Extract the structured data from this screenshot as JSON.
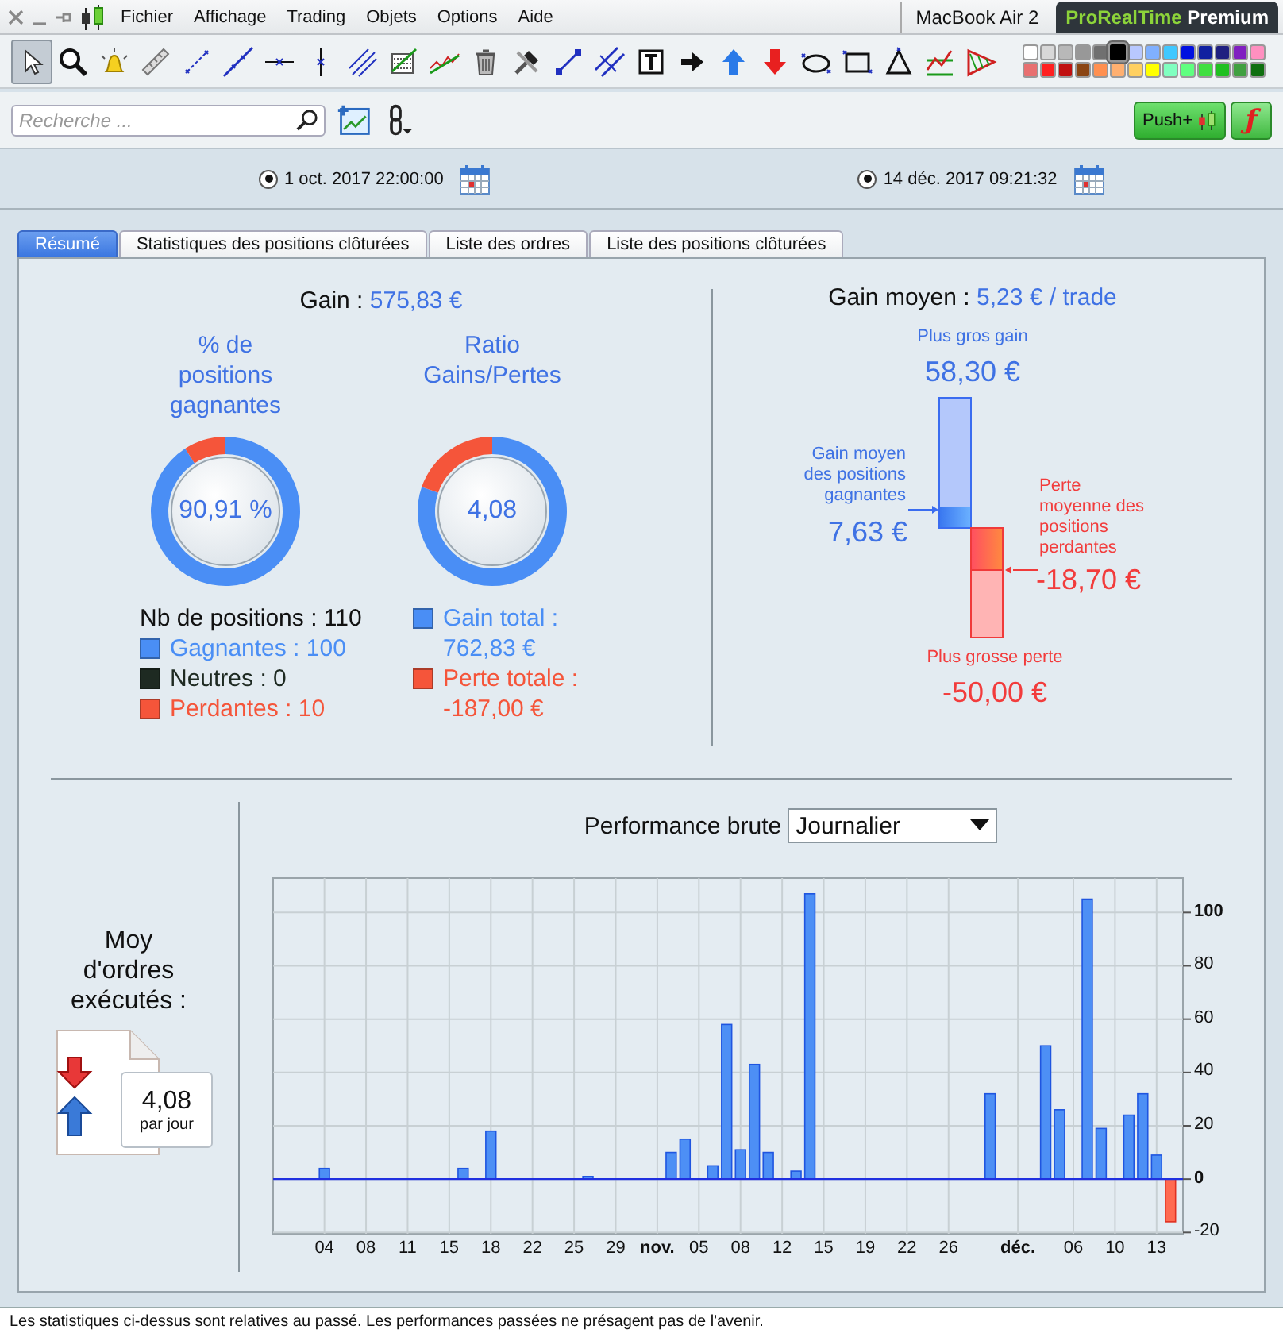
{
  "menu_bar": {
    "items": [
      "Fichier",
      "Affichage",
      "Trading",
      "Objets",
      "Options",
      "Aide"
    ],
    "device": "MacBook Air 2",
    "brand": {
      "name": "ProRealTime",
      "edition": "Premium"
    }
  },
  "toolbar": {
    "tools": [
      {
        "kind": "pointer",
        "selected": true
      },
      {
        "kind": "zoom",
        "selected": false
      },
      {
        "kind": "alert",
        "selected": false
      },
      {
        "kind": "ruler",
        "selected": false
      },
      {
        "kind": "segment",
        "selected": false
      },
      {
        "kind": "line",
        "selected": false
      },
      {
        "kind": "hline",
        "selected": false
      },
      {
        "kind": "vline",
        "selected": false
      },
      {
        "kind": "channel",
        "selected": false
      },
      {
        "kind": "grid",
        "selected": false
      },
      {
        "kind": "wave",
        "selected": false
      },
      {
        "kind": "trash",
        "selected": false
      },
      {
        "kind": "tools",
        "selected": false
      },
      {
        "kind": "extend",
        "selected": false
      },
      {
        "kind": "parallel",
        "selected": false
      },
      {
        "kind": "text",
        "selected": false
      },
      {
        "kind": "arrow_right",
        "selected": false
      },
      {
        "kind": "arrow_up",
        "selected": false
      },
      {
        "kind": "arrow_down",
        "selected": false
      },
      {
        "kind": "ellipse",
        "selected": false
      },
      {
        "kind": "rectangle",
        "selected": false
      },
      {
        "kind": "triangle",
        "selected": false
      },
      {
        "kind": "trend",
        "selected": false
      },
      {
        "kind": "wedge",
        "selected": false
      }
    ],
    "palette": [
      {
        "color": "#ffffff",
        "selected": false
      },
      {
        "color": "#d8d8d8",
        "selected": false
      },
      {
        "color": "#b8b8b8",
        "selected": false
      },
      {
        "color": "#989898",
        "selected": false
      },
      {
        "color": "#707070",
        "selected": false
      },
      {
        "color": "#000000",
        "selected": true
      },
      {
        "color": "#b8c8ff",
        "selected": false
      },
      {
        "color": "#80b0ff",
        "selected": false
      },
      {
        "color": "#40c8ff",
        "selected": false
      },
      {
        "color": "#0010e0",
        "selected": false
      },
      {
        "color": "#1020a0",
        "selected": false
      },
      {
        "color": "#202080",
        "selected": false
      },
      {
        "color": "#8020c0",
        "selected": false
      },
      {
        "color": "#ff90c0",
        "selected": false
      },
      {
        "color": "#e87070",
        "selected": false
      },
      {
        "color": "#ff2020",
        "selected": false
      },
      {
        "color": "#c01010",
        "selected": false
      },
      {
        "color": "#8b4513",
        "selected": false
      },
      {
        "color": "#ff9050",
        "selected": false
      },
      {
        "color": "#ffb070",
        "selected": false
      },
      {
        "color": "#ffd060",
        "selected": false
      },
      {
        "color": "#ffff00",
        "selected": false
      },
      {
        "color": "#80ffc0",
        "selected": false
      },
      {
        "color": "#60ff80",
        "selected": false
      },
      {
        "color": "#40e040",
        "selected": false
      },
      {
        "color": "#20c020",
        "selected": false
      },
      {
        "color": "#40a040",
        "selected": false
      },
      {
        "color": "#107010",
        "selected": false
      }
    ]
  },
  "search": {
    "placeholder": "Recherche ..."
  },
  "push_button": "Push+",
  "formula_button": "ƒ",
  "dates": [
    {
      "text": "1 oct. 2017 22:00:00",
      "selected": true
    },
    {
      "text": "14 déc. 2017 09:21:32",
      "selected": true
    }
  ],
  "tabs": [
    {
      "label": "Résumé",
      "selected": true
    },
    {
      "label": "Statistiques des positions clôturées",
      "selected": false
    },
    {
      "label": "Liste des ordres",
      "selected": false
    },
    {
      "label": "Liste des positions clôturées",
      "selected": false
    }
  ],
  "summary": {
    "gain": {
      "label": "Gain :",
      "value": "575,83 €"
    },
    "donuts": [
      {
        "title": "% de positions gagnantes",
        "center": "90,91 %",
        "chart_data": {
          "type": "donut",
          "values": [
            90.91,
            0,
            9.09
          ]
        }
      },
      {
        "title": "Ratio Gains/Pertes",
        "center": "4,08",
        "chart_data": {
          "type": "donut",
          "values": [
            80.31,
            19.69
          ]
        }
      }
    ],
    "positions": {
      "total": "Nb de positions : 110",
      "legend": [
        {
          "text": "Gagnantes : 100",
          "color": "#4a8ef5"
        },
        {
          "text": "Neutres : 0",
          "color": "#1e2a22"
        },
        {
          "text": "Perdantes : 10",
          "color": "#f5553a"
        }
      ]
    },
    "totals": [
      {
        "text": "Gain total : 762,83 €",
        "color": "#4a8ef5"
      },
      {
        "text": "Perte totale : -187,00 €",
        "color": "#f5553a"
      }
    ]
  },
  "average": {
    "label": "Gain moyen :",
    "value": "5,23 € / trade",
    "max_gain": {
      "label": "Plus gros gain",
      "value": "58,30 €"
    },
    "avg_gain": {
      "label": "Gain moyen des positions gagnantes",
      "value": "7,63 €"
    },
    "avg_loss": {
      "label": "Perte moyenne des positions perdantes",
      "value": "-18,70 €"
    },
    "max_loss": {
      "label": "Plus grosse perte",
      "value": "-50,00 €"
    }
  },
  "orders": {
    "label": "Moy d'ordres exécutés :",
    "value": "4,08",
    "unit": "par jour"
  },
  "performance": {
    "label": "Performance brute",
    "period": "Journalier",
    "chart_data": {
      "type": "bar",
      "categories": [
        null,
        null,
        null,
        "04",
        null,
        null,
        "08",
        null,
        null,
        "11",
        null,
        null,
        "15",
        null,
        null,
        "18",
        null,
        null,
        "22",
        null,
        null,
        "25",
        null,
        null,
        "29",
        null,
        null,
        "**nov.**",
        null,
        null,
        "05",
        null,
        null,
        "08",
        null,
        null,
        "12",
        null,
        null,
        "15",
        null,
        null,
        "19",
        null,
        null,
        "22",
        null,
        null,
        "26",
        null,
        null,
        null,
        null,
        "**déc.**",
        null,
        null,
        null,
        "06",
        null,
        null,
        "10",
        null,
        null,
        "13",
        null
      ],
      "series": [
        {
          "color": "#4d8ff5",
          "values": [
            null,
            null,
            null,
            4,
            null,
            null,
            null,
            null,
            null,
            null,
            null,
            null,
            null,
            4,
            null,
            18,
            null,
            null,
            null,
            null,
            null,
            null,
            1,
            null,
            null,
            null,
            null,
            null,
            10,
            15,
            null,
            5,
            58,
            11,
            43,
            10,
            null,
            3,
            107,
            null,
            null,
            null,
            null,
            null,
            null,
            null,
            null,
            null,
            null,
            null,
            null,
            32,
            null,
            null,
            null,
            50,
            26,
            null,
            105,
            19,
            null,
            24,
            32,
            9,
            null
          ]
        },
        {
          "color": "#ff6a50",
          "values": [
            null,
            null,
            null,
            null,
            null,
            null,
            null,
            null,
            null,
            null,
            null,
            null,
            null,
            null,
            null,
            null,
            null,
            null,
            null,
            null,
            null,
            null,
            null,
            null,
            null,
            null,
            null,
            null,
            null,
            null,
            null,
            null,
            null,
            null,
            null,
            null,
            null,
            null,
            null,
            null,
            null,
            null,
            null,
            null,
            null,
            null,
            null,
            null,
            null,
            null,
            null,
            null,
            null,
            null,
            null,
            null,
            null,
            null,
            null,
            null,
            null,
            null,
            null,
            null,
            -16
          ]
        }
      ],
      "ylim": [
        -20.5,
        112.9
      ],
      "grid": true,
      "ref_lines": [
        {
          "axis": "y",
          "value": 0,
          "color": "#2030e0"
        }
      ],
      "yticks": [
        {
          "value": -20,
          "label": "-20"
        },
        {
          "value": 0,
          "label": "**0**"
        },
        {
          "value": 20,
          "label": "20"
        },
        {
          "value": 40,
          "label": "40"
        },
        {
          "value": 60,
          "label": "60"
        },
        {
          "value": 80,
          "label": "80"
        },
        {
          "value": 100,
          "label": "**100**"
        }
      ]
    }
  },
  "status_bar": "Les statistiques ci-dessus sont relatives au passé. Les performances passées ne présagent pas de l'avenir."
}
